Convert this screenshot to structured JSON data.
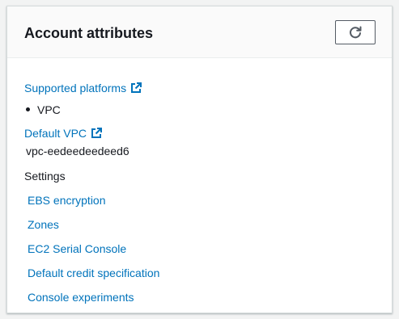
{
  "panel": {
    "title": "Account attributes",
    "refresh_icon": "refresh-icon"
  },
  "attributes": {
    "supported_platforms": {
      "label": "Supported platforms",
      "icon": "external-link-icon",
      "values": [
        "VPC"
      ]
    },
    "default_vpc": {
      "label": "Default VPC",
      "icon": "external-link-icon",
      "value": "vpc-eedeedeedeed6"
    },
    "settings": {
      "label": "Settings",
      "links": [
        "EBS encryption",
        "Zones",
        "EC2 Serial Console",
        "Default credit specification",
        "Console experiments"
      ]
    }
  },
  "colors": {
    "link": "#0073bb",
    "text": "#16191f",
    "header_bg": "#fafafa",
    "page_bg": "#f2f3f3"
  }
}
